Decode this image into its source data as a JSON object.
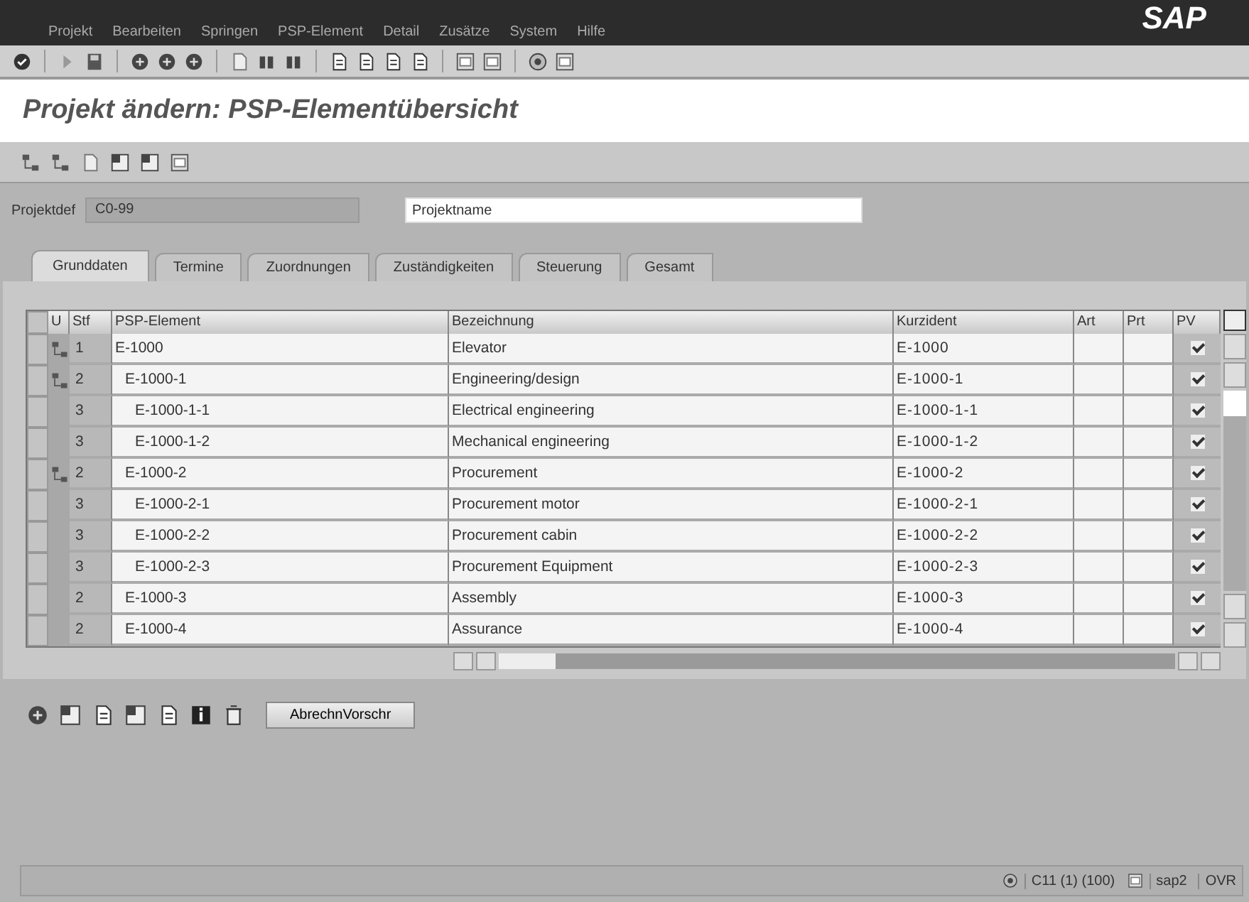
{
  "menu_bar": [
    "Projekt",
    "Bearbeiten",
    "Springen",
    "PSP-Element",
    "Detail",
    "Zusätze",
    "System",
    "Hilfe"
  ],
  "logo": "SAP",
  "title": "Projekt ändern: PSP-Elementübersicht",
  "project": {
    "label": "Projektdef",
    "value": "C0-99",
    "name_placeholder": "Projektname"
  },
  "tabs": [
    {
      "label": "Grunddaten",
      "selected": true
    },
    {
      "label": "Termine",
      "selected": false
    },
    {
      "label": "Zuordnungen",
      "selected": false
    },
    {
      "label": "Zuständigkeiten",
      "selected": false
    },
    {
      "label": "Steuerung",
      "selected": false
    },
    {
      "label": "Gesamt",
      "selected": false
    }
  ],
  "table": {
    "columns": [
      "U",
      "Stf",
      "PSP-Element",
      "Bezeichnung",
      "Kurzident",
      "Art",
      "Prt",
      "PV"
    ],
    "rows": [
      {
        "stf": "1",
        "element": "E-1000",
        "name": "Elevator",
        "short": "E-1000",
        "pv": true,
        "children": [
          {
            "stf": "2",
            "element": "E-1000-1",
            "name": "Engineering/design",
            "short": "E-1000-1",
            "pv": true,
            "children": [
              {
                "stf": "3",
                "element": "E-1000-1-1",
                "name": "Electrical engineering",
                "short": "E-1000-1-1",
                "pv": true
              },
              {
                "stf": "3",
                "element": "E-1000-1-2",
                "name": "Mechanical engineering",
                "short": "E-1000-1-2",
                "pv": true
              }
            ]
          },
          {
            "stf": "2",
            "element": "E-1000-2",
            "name": "Procurement",
            "short": "E-1000-2",
            "pv": true,
            "children": [
              {
                "stf": "3",
                "element": "E-1000-2-1",
                "name": "Procurement motor",
                "short": "E-1000-2-1",
                "pv": true
              },
              {
                "stf": "3",
                "element": "E-1000-2-2",
                "name": "Procurement cabin",
                "short": "E-1000-2-2",
                "pv": true
              },
              {
                "stf": "3",
                "element": "E-1000-2-3",
                "name": "Procurement Equipment",
                "short": "E-1000-2-3",
                "pv": true
              }
            ]
          },
          {
            "stf": "2",
            "element": "E-1000-3",
            "name": "Assembly",
            "short": "E-1000-3",
            "pv": true
          },
          {
            "stf": "2",
            "element": "E-1000-4",
            "name": "Assurance",
            "short": "E-1000-4",
            "pv": true
          }
        ]
      }
    ]
  },
  "bottom_button": "AbrechnVorschr",
  "status_bar": {
    "system": "C11 (1) (100)",
    "server": "sap2",
    "mode": "OVR"
  }
}
